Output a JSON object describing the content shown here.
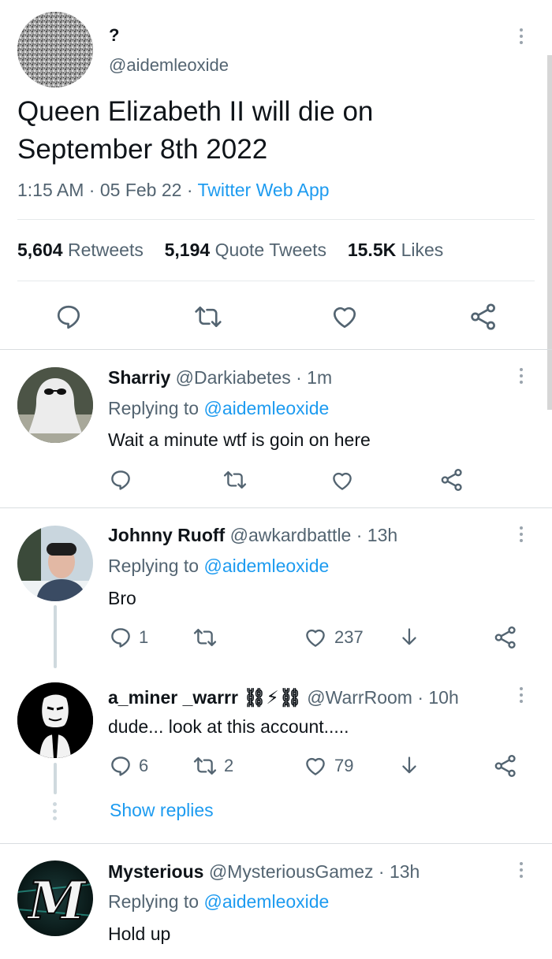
{
  "tweet": {
    "display_name": "?",
    "handle": "@aidemleoxide",
    "text_line1": "Queen Elizabeth II will die on",
    "text_line2": "September 8th 2022",
    "time": "1:15 AM",
    "sep1": "·",
    "date": "05 Feb 22",
    "sep2": "·",
    "source": "Twitter Web App",
    "stats": {
      "retweets_count": "5,604",
      "retweets_label": "Retweets",
      "quotes_count": "5,194",
      "quotes_label": "Quote Tweets",
      "likes_count": "15.5K",
      "likes_label": "Likes"
    }
  },
  "replies": [
    {
      "name": "Sharriy",
      "handle": "@Darkiabetes",
      "time": "· 1m",
      "replying_prefix": "Replying to",
      "replying_to": "@aidemleoxide",
      "text": "Wait a minute wtf is goin on here",
      "reply_count": "",
      "retweet_count": "",
      "like_count": ""
    },
    {
      "name": "Johnny Ruoff",
      "handle": "@awkardbattle",
      "time": "· 13h",
      "replying_prefix": "Replying to",
      "replying_to": "@aidemleoxide",
      "text": "Bro",
      "reply_count": "1",
      "retweet_count": "",
      "like_count": "237"
    },
    {
      "name": "a_miner _warrr ⛓⚡⛓",
      "handle": "@WarrRoom",
      "time": "· 10h",
      "text": "dude... look at this account.....",
      "reply_count": "6",
      "retweet_count": "2",
      "like_count": "79",
      "show_replies": "Show replies"
    },
    {
      "name": "Mysterious",
      "handle": "@MysteriousGamez",
      "time": "· 13h",
      "replying_prefix": "Replying to",
      "replying_to": "@aidemleoxide",
      "text": "Hold up",
      "avatar_letter": "M"
    }
  ],
  "colors": {
    "accent": "#1d9bf0",
    "text": "#0f1419",
    "secondary": "#536471",
    "divider": "#e6e9eb"
  },
  "icons": [
    "more-icon",
    "reply-icon",
    "retweet-icon",
    "like-icon",
    "share-icon",
    "download-icon"
  ]
}
